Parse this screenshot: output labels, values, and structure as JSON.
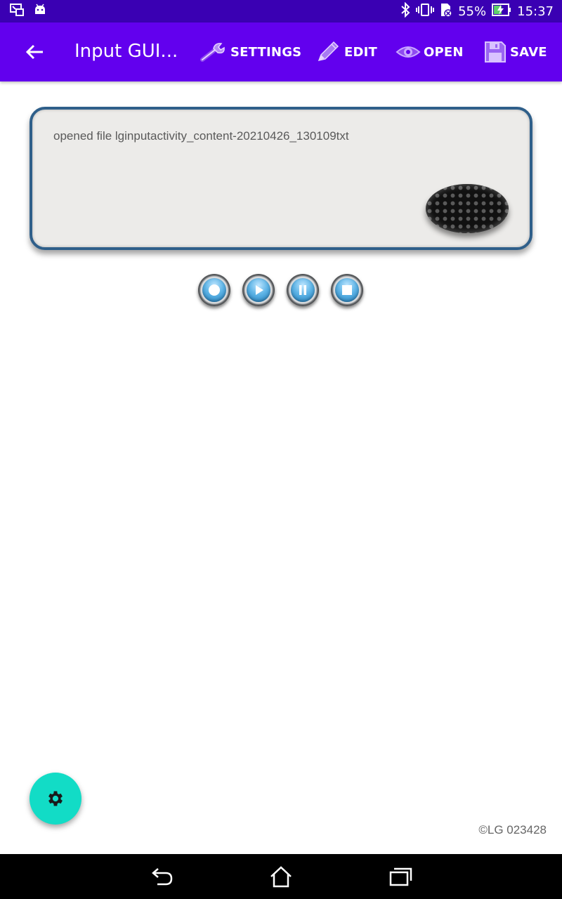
{
  "status_bar": {
    "battery": "55%",
    "time": "15:37"
  },
  "app_bar": {
    "title": "Input GUI...",
    "actions": {
      "settings": "SETTINGS",
      "edit": "EDIT",
      "open": "OPEN",
      "save": "SAVE"
    }
  },
  "panel": {
    "text": "opened file lginputactivity_content-20210426_130109txt"
  },
  "media_controls": [
    "record",
    "play",
    "pause",
    "stop"
  ],
  "footer": {
    "credit": "©LG 023428"
  },
  "colors": {
    "status_bar": "#3a00b3",
    "app_bar": "#6200ee",
    "fab": "#12dcc6",
    "panel_border": "#2f5f8a"
  }
}
